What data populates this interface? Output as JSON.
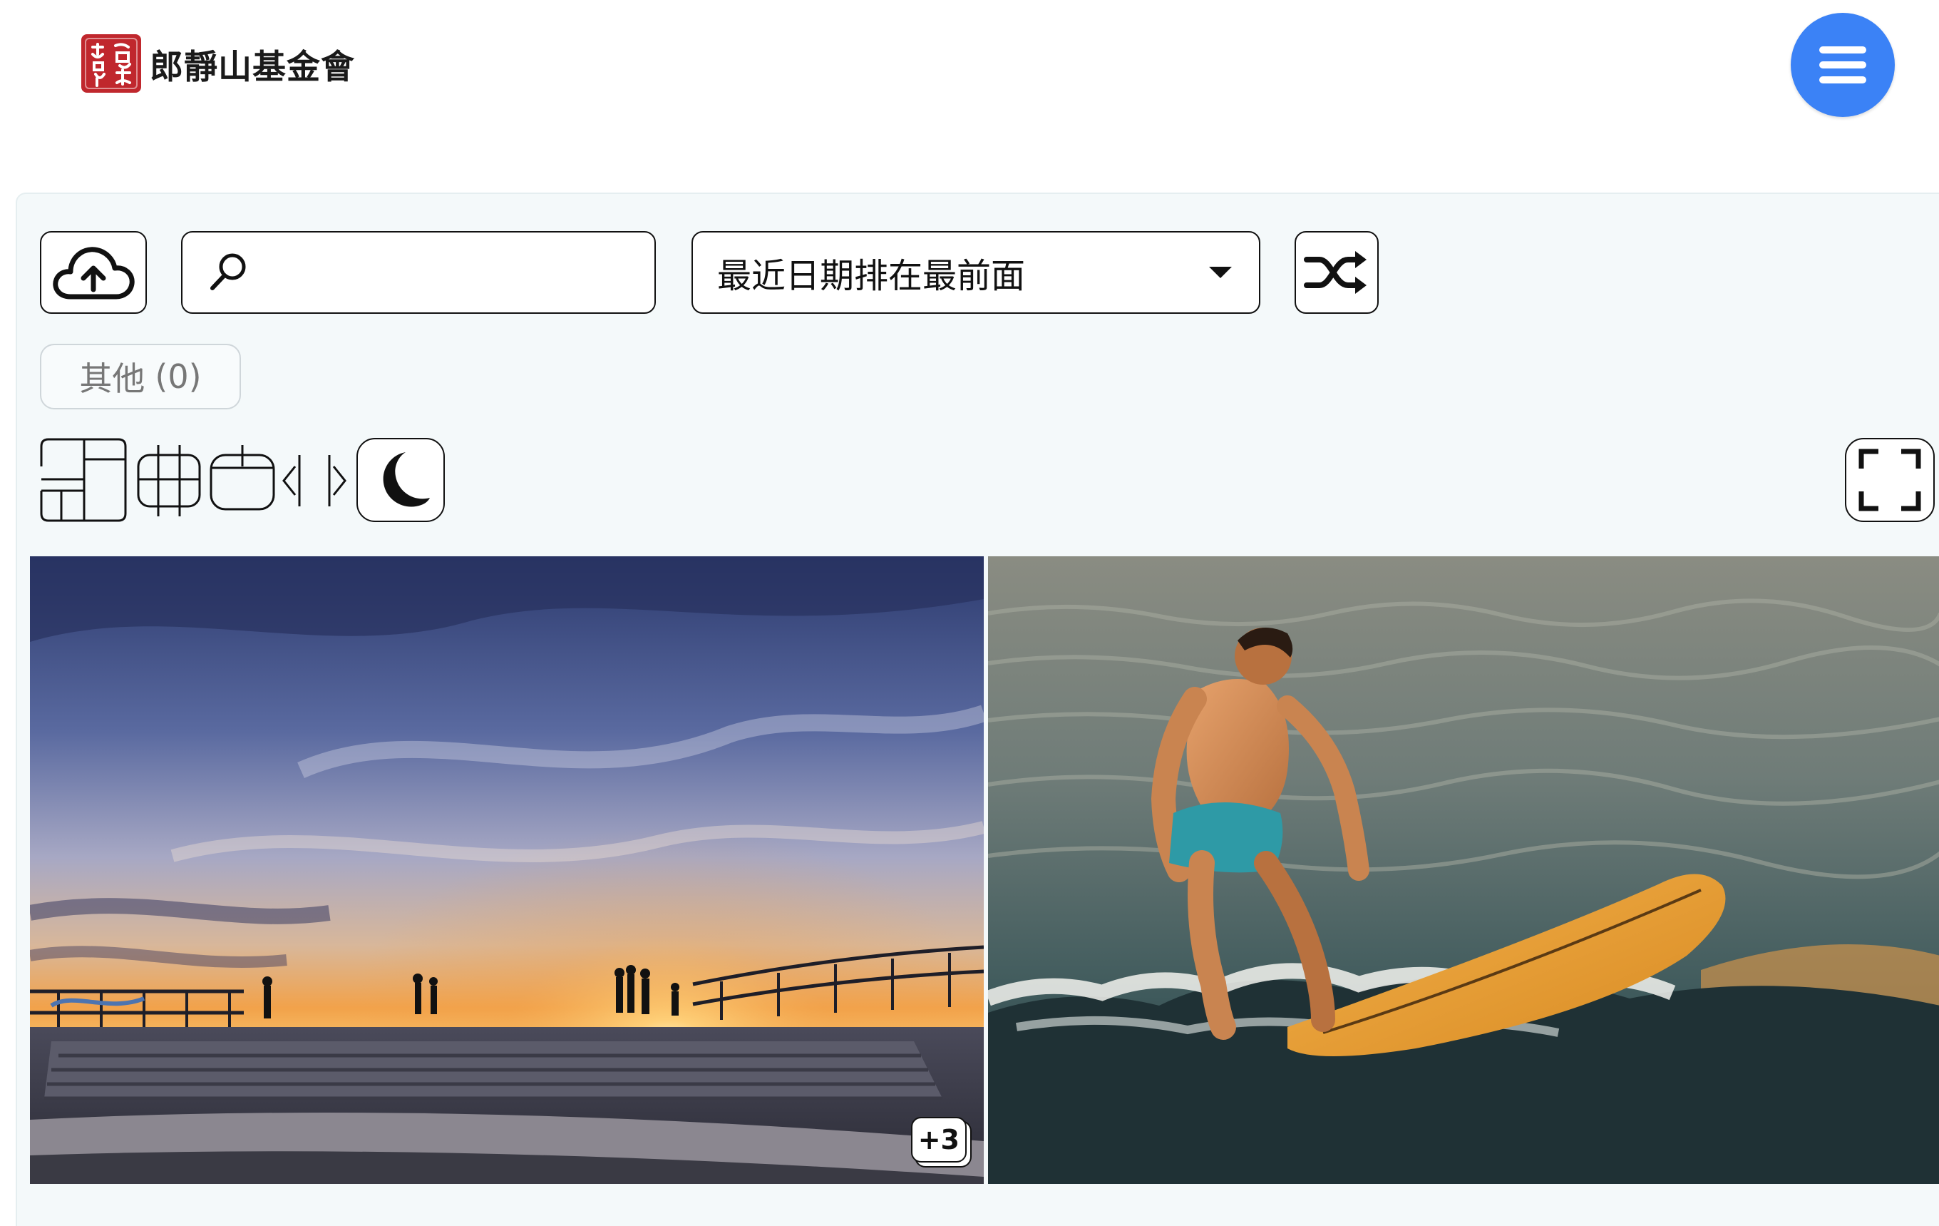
{
  "header": {
    "brand_name": "郎靜山基金會",
    "menu_icon": "hamburger-icon",
    "accent_color": "#3b82f6"
  },
  "toolbar": {
    "upload_icon": "cloud-upload-icon",
    "search": {
      "value": "",
      "placeholder": ""
    },
    "sort": {
      "selected": "最近日期排在最前面"
    },
    "shuffle_icon": "shuffle-icon"
  },
  "tags": [
    {
      "label": "其他",
      "count": "(0)"
    }
  ],
  "layout_tools": {
    "icons": [
      "layout-masonry-icon",
      "layout-grid-icon",
      "layout-columns-icon",
      "size-decrease-icon",
      "size-increase-icon",
      "moon-icon",
      "fullscreen-icon"
    ]
  },
  "gallery": {
    "items": [
      {
        "subject": "sunset-pier",
        "badge": "+3"
      },
      {
        "subject": "surfer",
        "badge": ""
      }
    ]
  }
}
